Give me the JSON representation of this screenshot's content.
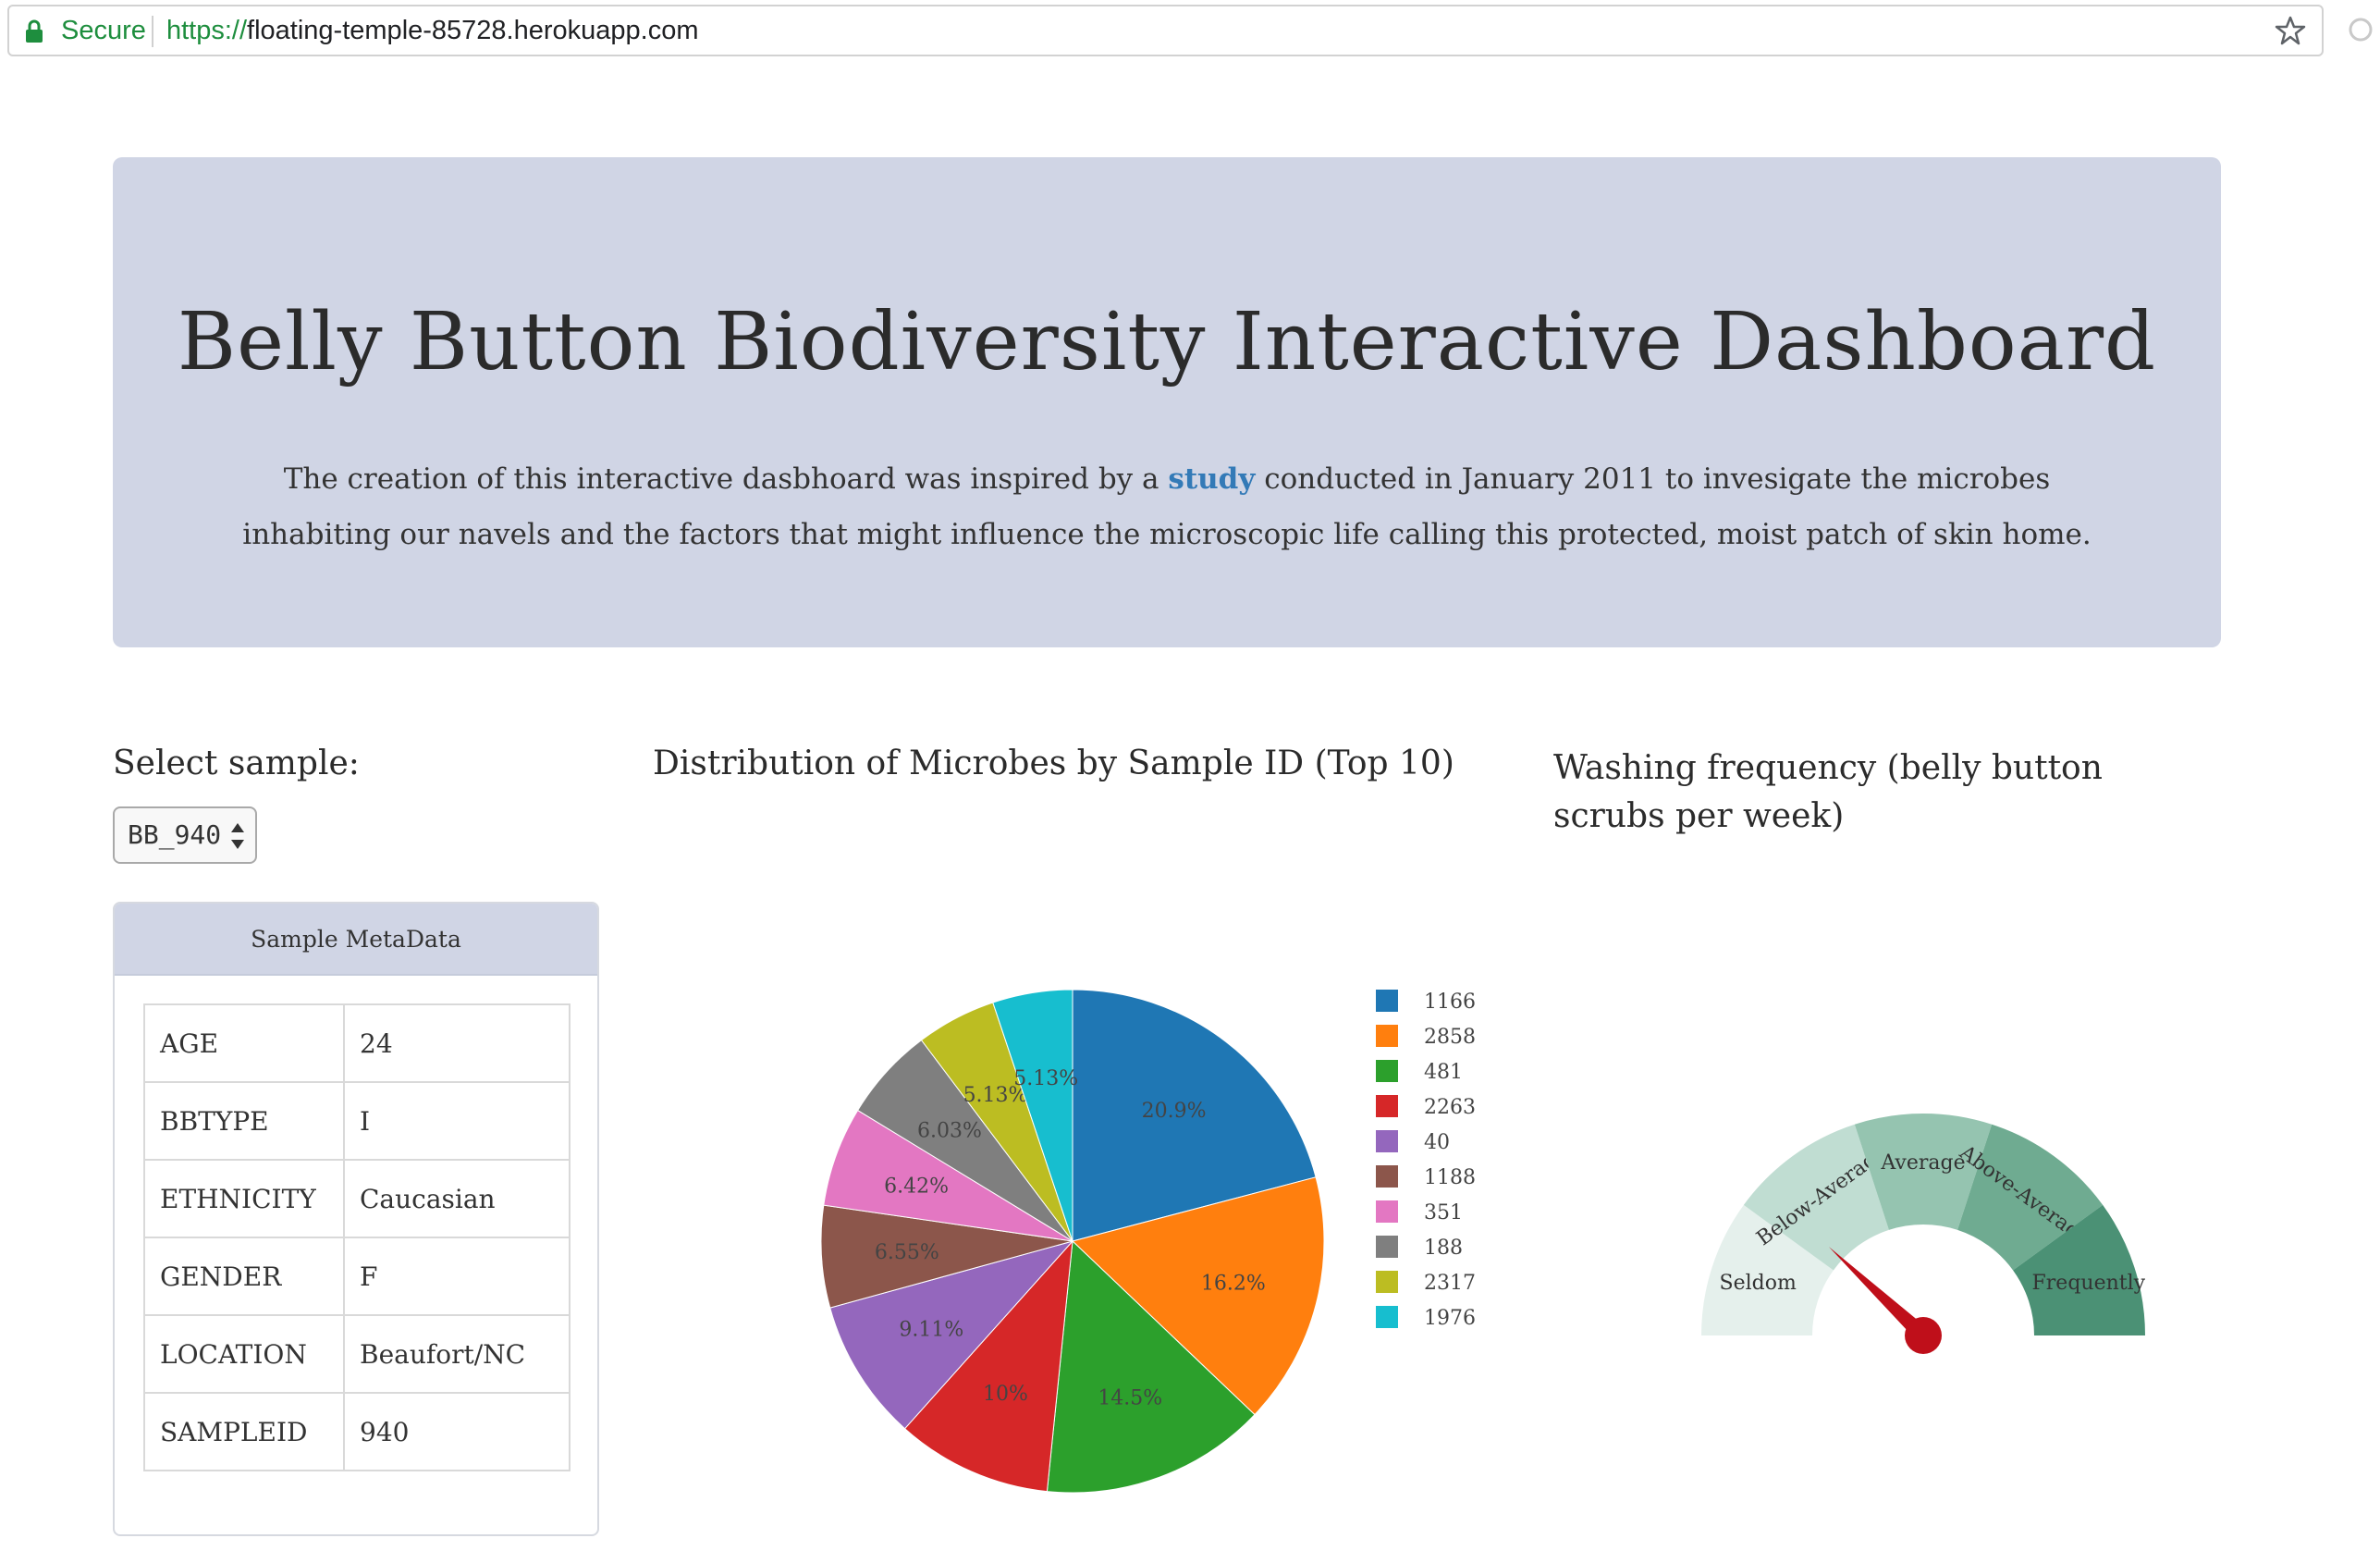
{
  "browser": {
    "secure_label": "Secure",
    "url_protocol": "https://",
    "url_rest": "floating-temple-85728.herokuapp.com"
  },
  "header": {
    "title": "Belly Button Biodiversity Interactive Dashboard",
    "desc_before": "The creation of this interactive dasbhoard was inspired by a ",
    "study_link": "study",
    "desc_after": " conducted in January 2011 to invesigate the microbes inhabiting our navels and the factors that might influence the microscopic life calling this protected, moist patch of skin home."
  },
  "selector": {
    "label": "Select sample:",
    "selected": "BB_940"
  },
  "metadata": {
    "heading": "Sample MetaData",
    "rows": [
      {
        "key": "AGE",
        "value": "24"
      },
      {
        "key": "BBTYPE",
        "value": "I"
      },
      {
        "key": "ETHNICITY",
        "value": "Caucasian"
      },
      {
        "key": "GENDER",
        "value": "F"
      },
      {
        "key": "LOCATION",
        "value": "Beaufort/NC"
      },
      {
        "key": "SAMPLEID",
        "value": "940"
      }
    ]
  },
  "pie": {
    "title": "Distribution of Microbes by Sample ID (Top 10)"
  },
  "gauge": {
    "title": "Washing frequency (belly button scrubs per week)",
    "labels": [
      "Seldom",
      "Below-Average",
      "Average",
      "Above-Average",
      "Frequently"
    ],
    "colors": [
      "#e5f0ec",
      "#c0ddd2",
      "#95c4b0",
      "#6fab91",
      "#4b9175"
    ],
    "needle_color": "#bf0f1a"
  },
  "chart_data": {
    "type": "pie",
    "title": "Distribution of Microbes by Sample ID (Top 10)",
    "categories": [
      "1166",
      "2858",
      "481",
      "2263",
      "40",
      "1188",
      "351",
      "188",
      "2317",
      "1976"
    ],
    "values": [
      20.9,
      16.2,
      14.5,
      10,
      9.11,
      6.55,
      6.42,
      6.03,
      5.13,
      5.13
    ],
    "labels": [
      "20.9%",
      "16.2%",
      "14.5%",
      "10%",
      "9.11%",
      "6.55%",
      "6.42%",
      "6.03%",
      "5.13%",
      "5.13%"
    ],
    "colors": [
      "#1f77b4",
      "#ff7f0e",
      "#2ca02c",
      "#d62728",
      "#9467bd",
      "#8c564b",
      "#e377c2",
      "#7f7f7f",
      "#bcbd22",
      "#17becf"
    ],
    "legend_position": "right"
  }
}
